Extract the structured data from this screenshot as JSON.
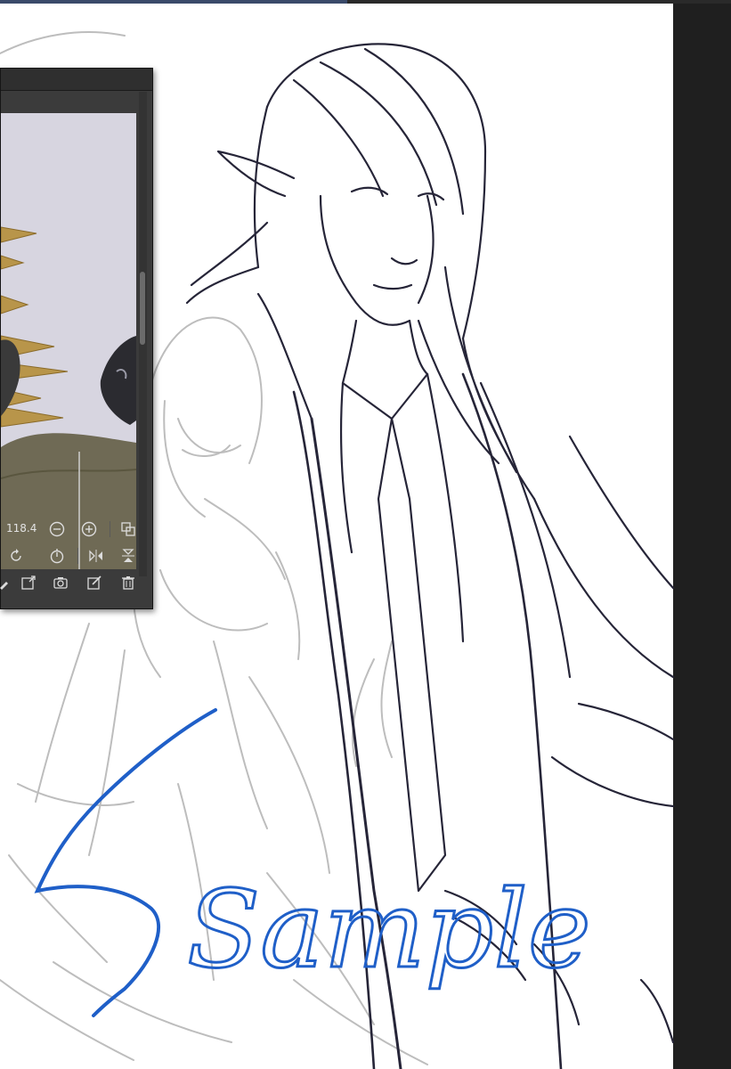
{
  "reference_panel": {
    "zoom_value": "118.4",
    "icons": {
      "zoom_out": "minus-circle-icon",
      "zoom_in": "plus-circle-icon",
      "fit": "fit-view-icon",
      "rotate": "rotate-icon",
      "reset_rotation": "reset-rotation-icon",
      "flip_horizontal": "flip-horizontal-icon",
      "flip_vertical": "flip-vertical-icon",
      "pick_color": "eyedropper-icon",
      "import_image": "import-image-icon",
      "snapshot": "camera-icon",
      "edit": "edit-icon",
      "delete": "trash-icon"
    }
  },
  "canvas": {
    "annotation_text": "Sample",
    "annotation_color": "#1f5fc8",
    "line_color": "#262538",
    "sketch_color": "#bdbdbd"
  }
}
